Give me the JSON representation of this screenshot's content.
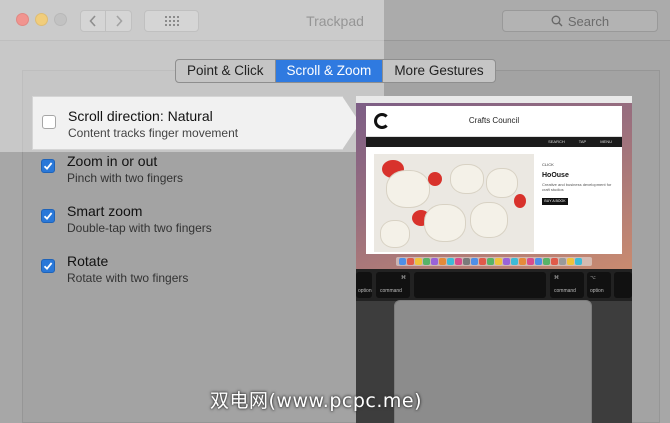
{
  "window": {
    "title": "Trackpad",
    "search_placeholder": "Search"
  },
  "tabs": [
    {
      "label": "Point & Click",
      "active": false
    },
    {
      "label": "Scroll & Zoom",
      "active": true
    },
    {
      "label": "More Gestures",
      "active": false
    }
  ],
  "options": [
    {
      "title": "Scroll direction: Natural",
      "subtitle": "Content tracks finger movement",
      "checked": false
    },
    {
      "title": "Zoom in or out",
      "subtitle": "Pinch with two fingers",
      "checked": true
    },
    {
      "title": "Smart zoom",
      "subtitle": "Double-tap with two fingers",
      "checked": true
    },
    {
      "title": "Rotate",
      "subtitle": "Rotate with two fingers",
      "checked": true
    }
  ],
  "preview": {
    "site_name": "Crafts Council",
    "nav": [
      "SEARCH",
      "TAP",
      "MENU"
    ],
    "kicker": "CLICK",
    "headline": "HoOuse",
    "body": "Creative and business development for craft studios",
    "button": "BUY A BOOK",
    "key_left_top": "⌘",
    "key_left_bottom": "command",
    "key_right_top": "⌘",
    "key_right_bottom": "command",
    "key_opt_top": "⌥",
    "key_opt_bottom": "option",
    "key_far_left_bottom": "option"
  },
  "watermark": "双电网(www.pcpc.me)",
  "colors": {
    "accent": "#2f7ae0",
    "checkbox": "#2a78d8",
    "close": "#e9534b",
    "minimize": "#e8ae2a"
  }
}
